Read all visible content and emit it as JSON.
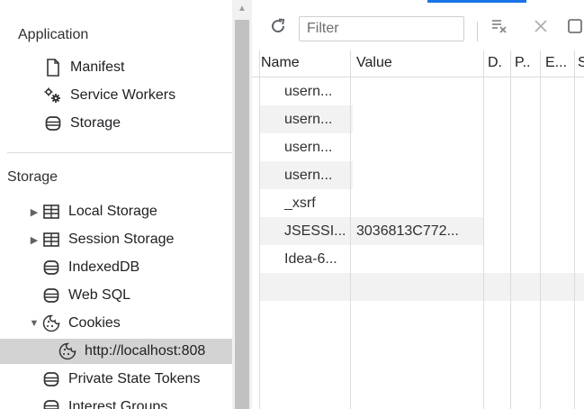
{
  "left_pane": {
    "application_header": "Application",
    "application_items": [
      {
        "label": "Manifest",
        "icon": "document-icon"
      },
      {
        "label": "Service Workers",
        "icon": "gears-icon"
      },
      {
        "label": "Storage",
        "icon": "database-icon"
      }
    ],
    "storage_header": "Storage",
    "storage_items": [
      {
        "label": "Local Storage",
        "icon": "grid-icon",
        "expandable": "collapsed"
      },
      {
        "label": "Session Storage",
        "icon": "grid-icon",
        "expandable": "collapsed"
      },
      {
        "label": "IndexedDB",
        "icon": "database-icon"
      },
      {
        "label": "Web SQL",
        "icon": "database-icon"
      },
      {
        "label": "Cookies",
        "icon": "cookie-icon",
        "expandable": "expanded"
      },
      {
        "label": "http://localhost:808",
        "icon": "cookie-icon",
        "selected": true
      },
      {
        "label": "Private State Tokens",
        "icon": "database-icon"
      },
      {
        "label": "Interest Groups",
        "icon": "database-icon"
      }
    ]
  },
  "toolbar": {
    "refresh_icon": "refresh-icon",
    "filter_placeholder": "Filter",
    "clear_filtered_icon": "clear-filtered-icon",
    "delete_icon": "close-icon",
    "checkbox_icon": "checkbox-icon"
  },
  "table": {
    "columns": [
      "Name",
      "Value",
      "D.",
      "P..",
      "E...",
      "S"
    ],
    "rows": [
      {
        "name": "usern...",
        "value": ""
      },
      {
        "name": "usern...",
        "value": ""
      },
      {
        "name": "usern...",
        "value": ""
      },
      {
        "name": "usern...",
        "value": ""
      },
      {
        "name": "_xsrf",
        "value": ""
      },
      {
        "name": "JSESSI...",
        "value": "3036813C772..."
      },
      {
        "name": "Idea-6...",
        "value": ""
      }
    ]
  },
  "colors": {
    "accent": "#1a73e8",
    "selected_bg": "#d3d3d3",
    "stripe_bg": "#f2f2f2"
  }
}
